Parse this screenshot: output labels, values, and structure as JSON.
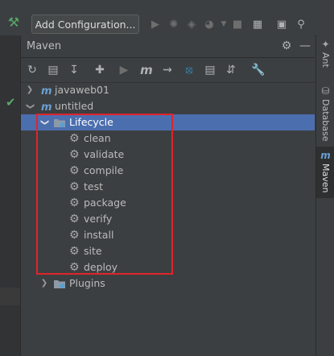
{
  "top_toolbar": {
    "add_configuration": "Add Configuration...",
    "icons": [
      "hammer-icon",
      "run-icon",
      "debug-icon",
      "coverage-icon",
      "profile-icon",
      "dropdown-icon",
      "stop-icon",
      "project-structure-icon",
      "terminal-icon",
      "search-icon"
    ]
  },
  "panel": {
    "title": "Maven",
    "header_icons": [
      "gear-icon",
      "minimize-icon"
    ],
    "toolbar_icons": [
      "reload-icon",
      "add-folder-icon",
      "download-icon",
      "plus-icon",
      "run-icon",
      "maven-m-icon",
      "toggle-offline-icon",
      "skip-tests-icon",
      "show-dependencies-icon",
      "collapse-icon",
      "settings-wrench-icon"
    ]
  },
  "tree": {
    "projects": [
      {
        "label": "javaweb01",
        "expanded": false
      },
      {
        "label": "untitled",
        "expanded": true
      }
    ],
    "lifecycle": {
      "label": "Lifecycle",
      "goals": [
        "clean",
        "validate",
        "compile",
        "test",
        "package",
        "verify",
        "install",
        "site",
        "deploy"
      ]
    },
    "plugins": {
      "label": "Plugins"
    }
  },
  "right_sidebar": {
    "tabs": [
      "Ant",
      "Database",
      "Maven"
    ]
  },
  "colors": {
    "background": "#3c3f41",
    "selection": "#4b6eaf",
    "highlight_border": "#e0242b",
    "check_green": "#59a869"
  }
}
